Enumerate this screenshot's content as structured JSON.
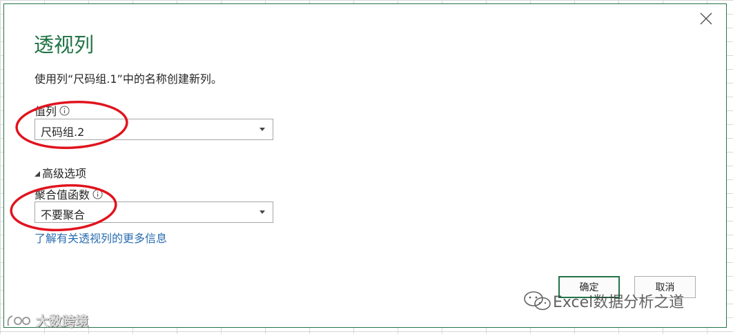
{
  "dialog": {
    "title": "透视列",
    "description": "使用列“尺码组.1”中的名称创建新列。",
    "value_column": {
      "label": "值列",
      "selected": "尺码组.2"
    },
    "advanced": {
      "label": "高级选项"
    },
    "aggregate_function": {
      "label": "聚合值函数",
      "selected": "不要聚合"
    },
    "learn_more_link": "了解有关透视列的更多信息",
    "ok_label": "确定",
    "cancel_label": "取消"
  },
  "watermarks": {
    "right_text": "Excel数据分析之道",
    "left_text": "大数跨境"
  },
  "colors": {
    "title_green": "#217346",
    "link_blue": "#2a6db0",
    "annotation_red": "#e0141e"
  },
  "icons": {
    "close": "close-icon",
    "info": "info-icon",
    "dropdown": "chevron-down-icon",
    "expand": "triangle-expanded-icon",
    "wechat": "wechat-icon"
  }
}
